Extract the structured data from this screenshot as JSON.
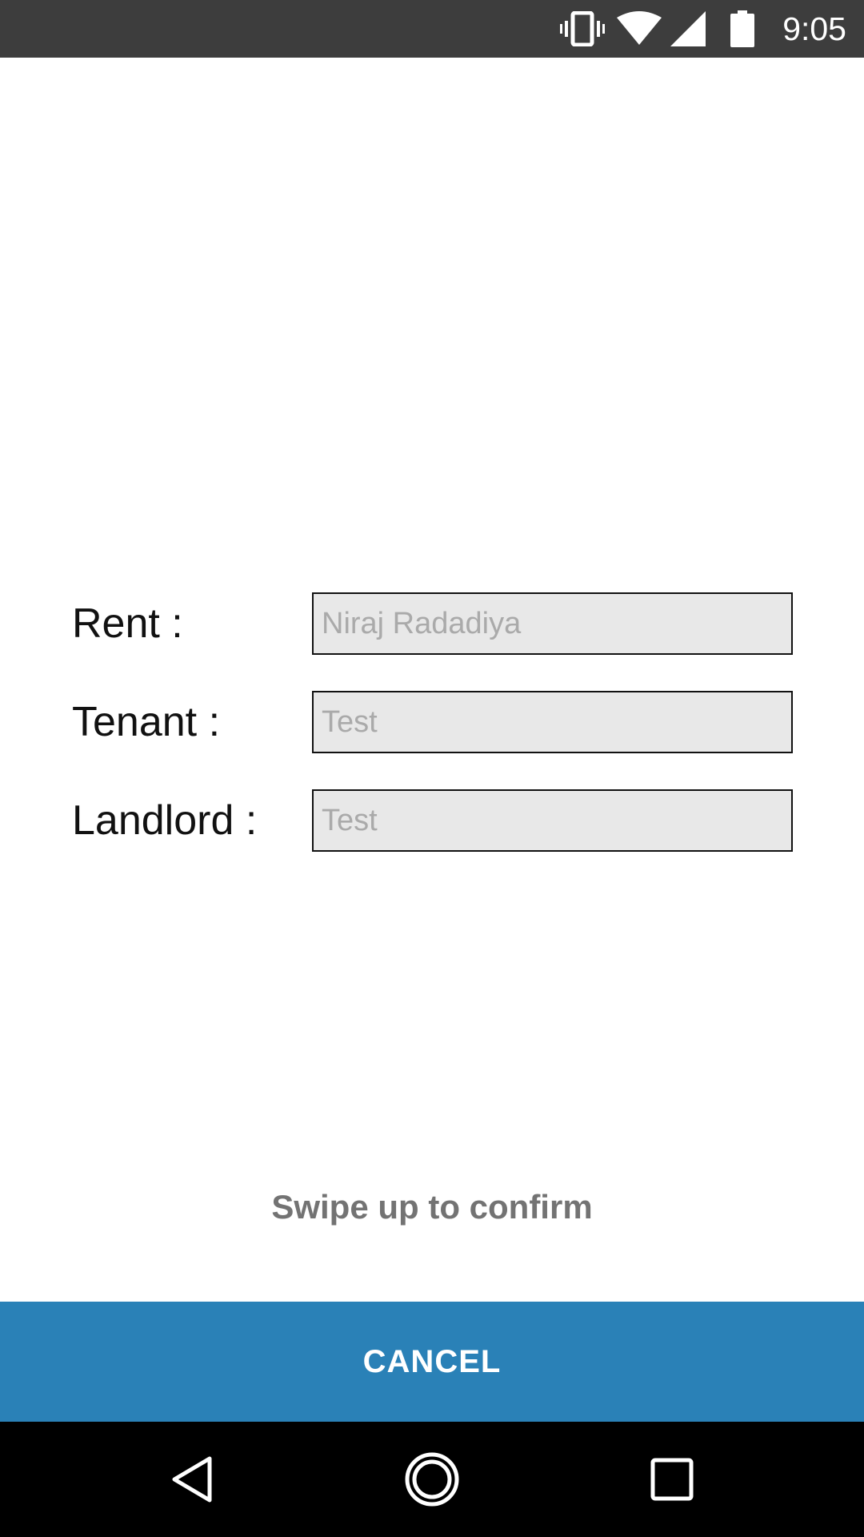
{
  "status_bar": {
    "time": "9:05",
    "icons": [
      "vibrate-icon",
      "wifi-icon",
      "cellular-signal-icon",
      "battery-icon"
    ]
  },
  "form": {
    "fields": [
      {
        "label": "Rent :",
        "value": "",
        "placeholder": "Niraj Radadiya"
      },
      {
        "label": "Tenant :",
        "value": "",
        "placeholder": "Test"
      },
      {
        "label": "Landlord :",
        "value": "",
        "placeholder": "Test"
      }
    ]
  },
  "swipe_hint": "Swipe up to confirm",
  "cancel_label": "CANCEL",
  "nav_bar": {
    "icons": [
      "back-icon",
      "home-icon",
      "recents-icon"
    ]
  },
  "colors": {
    "status_bar_bg": "#3d3d3d",
    "field_bg": "#e8e8e8",
    "cancel_bg": "#2a81b7",
    "hint_text": "#737373",
    "nav_bar_bg": "#000000"
  }
}
